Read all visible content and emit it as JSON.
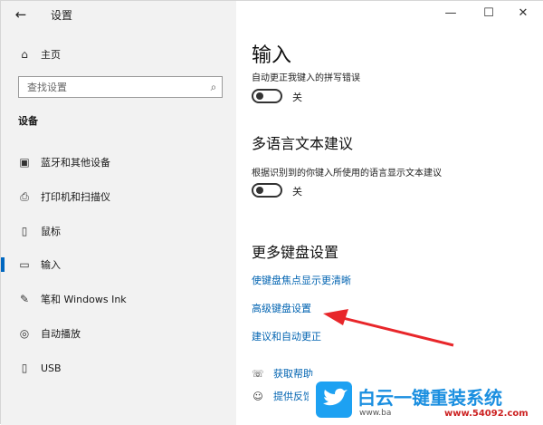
{
  "window": {
    "title": "设置",
    "back_icon": "←",
    "minimize_icon": "—",
    "maximize_icon": "☐",
    "close_icon": "✕"
  },
  "sidebar": {
    "home_label": "主页",
    "home_icon": "⌂",
    "search_placeholder": "查找设置",
    "search_icon": "⌕",
    "section_title": "设备",
    "items": [
      {
        "label": "蓝牙和其他设备",
        "icon": "▣"
      },
      {
        "label": "打印机和扫描仪",
        "icon": "⎙"
      },
      {
        "label": "鼠标",
        "icon": "▯"
      },
      {
        "label": "输入",
        "icon": "▭"
      },
      {
        "label": "笔和 Windows Ink",
        "icon": "✎"
      },
      {
        "label": "自动播放",
        "icon": "◎"
      },
      {
        "label": "USB",
        "icon": "▯"
      }
    ],
    "active_index": 3
  },
  "main": {
    "page_title": "输入",
    "autocorrect_label": "自动更正我键入的拼写错误",
    "autocorrect_state": "关",
    "multilang_title": "多语言文本建议",
    "multilang_desc": "根据识别到的你键入所使用的语言显示文本建议",
    "multilang_state": "关",
    "more_title": "更多键盘设置",
    "links": [
      "使键盘焦点显示更清晰",
      "高级键盘设置",
      "建议和自动更正"
    ],
    "help": [
      {
        "label": "获取帮助",
        "icon": "☏"
      },
      {
        "label": "提供反馈",
        "icon": "☺"
      }
    ]
  },
  "watermark": {
    "brand": "白云一键重装系统",
    "url": "www.ba",
    "site": "www.54092.com",
    "colors": {
      "bird_bg": "#1da1f2",
      "brand_text": "#1b8fe0",
      "site_text": "#cc2222"
    }
  },
  "annotation": {
    "arrow_color": "#e8262a"
  }
}
